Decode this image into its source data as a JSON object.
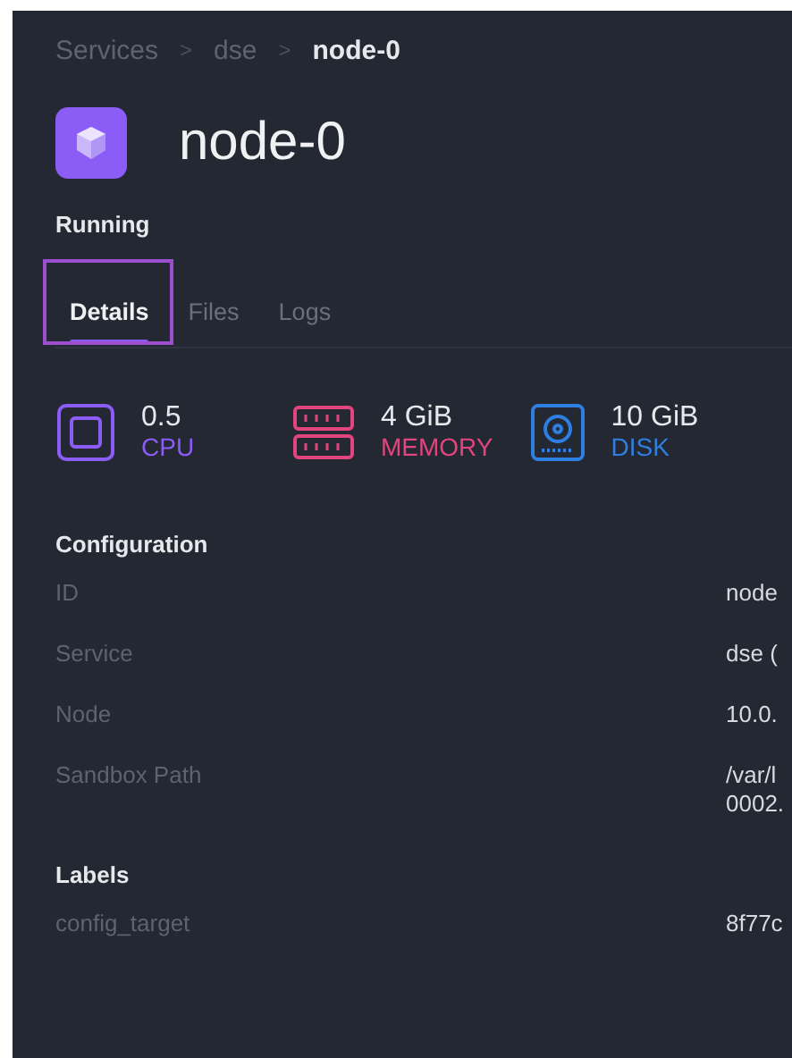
{
  "breadcrumb": [
    {
      "label": "Services",
      "current": false
    },
    {
      "label": "dse",
      "current": false
    },
    {
      "label": "node-0",
      "current": true
    }
  ],
  "breadcrumb_separator": ">",
  "title": "node-0",
  "status": "Running",
  "tabs": [
    {
      "label": "Details",
      "selected": true
    },
    {
      "label": "Files",
      "selected": false
    },
    {
      "label": "Logs",
      "selected": false
    }
  ],
  "resources": [
    {
      "kind": "cpu",
      "value": "0.5",
      "label": "CPU",
      "color": "#8b5cf6"
    },
    {
      "kind": "memory",
      "value": "4 GiB",
      "label": "MEMORY",
      "color": "#e0457b"
    },
    {
      "kind": "disk",
      "value": "10 GiB",
      "label": "DISK",
      "color": "#2f7fe0"
    }
  ],
  "sections": [
    {
      "heading": "Configuration",
      "rows": [
        {
          "key": "ID",
          "value": [
            "node"
          ]
        },
        {
          "key": "Service",
          "value": [
            "dse ("
          ]
        },
        {
          "key": "Node",
          "value": [
            "10.0."
          ]
        },
        {
          "key": "Sandbox Path",
          "value": [
            "/var/l",
            "0002."
          ]
        }
      ]
    },
    {
      "heading": "Labels",
      "rows": [
        {
          "key": "config_target",
          "value": [
            "8f77c"
          ]
        }
      ]
    }
  ]
}
